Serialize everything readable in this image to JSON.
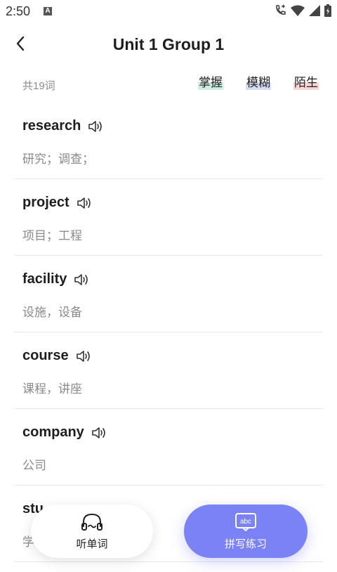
{
  "status": {
    "time": "2:50",
    "badge": "A"
  },
  "header": {
    "title": "Unit 1 Group 1"
  },
  "summary": {
    "count": "共19词",
    "legend": {
      "mastered": "掌握",
      "fuzzy": "模糊",
      "strange": "陌生"
    },
    "colors": {
      "mastered": "#cdeee0",
      "fuzzy": "#d6dcf6",
      "strange": "#f8d6d6"
    }
  },
  "words": [
    {
      "word": "research",
      "meaning": "研究；调查；"
    },
    {
      "word": "project",
      "meaning": "项目；工程"
    },
    {
      "word": "facility",
      "meaning": "设施，设备"
    },
    {
      "word": "course",
      "meaning": "课程，讲座"
    },
    {
      "word": "company",
      "meaning": "公司"
    },
    {
      "word": "stu",
      "meaning": "学"
    }
  ],
  "actions": {
    "listen_label": "听单词",
    "listen_icon": "headphones-icon",
    "spell_label": "拼写练习",
    "spell_icon": "abc-board-icon",
    "accent": "#7b82f3"
  }
}
